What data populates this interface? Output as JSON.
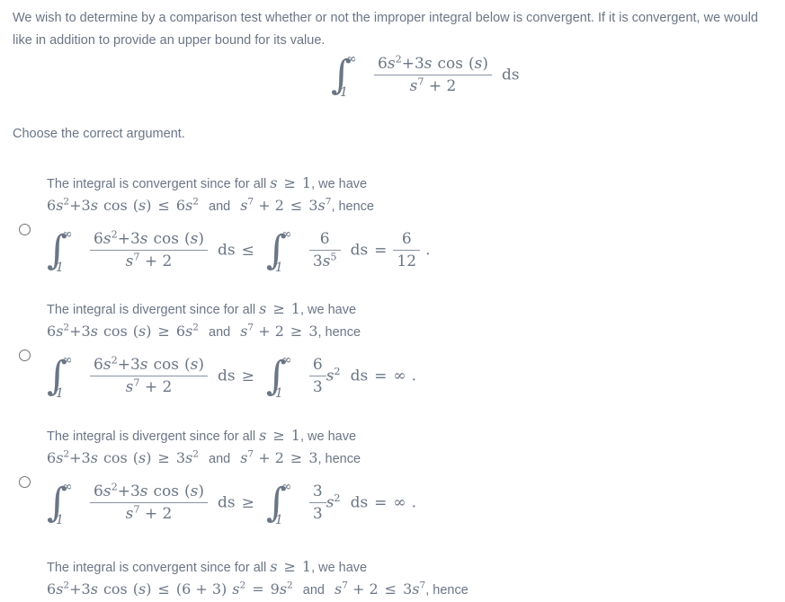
{
  "question": {
    "stem_line1": "We wish to determine by a comparison test whether or not the improper integral below is convergent. If it is convergent, we would",
    "stem_line2": "like in addition to provide an upper bound for its value.",
    "prompt": "Choose the correct argument.",
    "integral": {
      "lower_limit": "1",
      "upper_limit": "∞",
      "numerator": "6s²+3s cos (s)",
      "denominator": "s⁷ + 2",
      "differential": "ds",
      "plain": "∫₁^∞ (6s²+3s cos(s)) / (s⁷ + 2) ds"
    }
  },
  "icons": {
    "radio_unselected": "radio-unselected-icon"
  },
  "colors": {
    "text": "#6b7585",
    "math": "#6b7585",
    "rule": "#8892a0",
    "radio_border": "#737373",
    "background": "#ffffff"
  },
  "options": [
    {
      "id": "option-a",
      "selected": false,
      "line1_pre": "The integral is convergent since for all ",
      "line1_var": "s",
      "line1_rel": "≥",
      "line1_val": "1",
      "line1_post": ", we have",
      "line2": {
        "lhs_coef": "6",
        "lhs": "6s²+3s cos (s)",
        "rel1": "≤",
        "rhs1_coef": "6",
        "rhs1": "6s²",
        "and": "and",
        "lhs2": "s⁷ + 2",
        "rel2": "≤",
        "rhs2": "3s⁷",
        "tail": ", hence"
      },
      "display": {
        "left_integral_num": "6s²+3s cos (s)",
        "left_integral_den": "s⁷ + 2",
        "relation": "≤",
        "right_integral_num": "6",
        "right_integral_den": "3s⁵",
        "result_num": "6",
        "result_den": "12",
        "equals": "=",
        "period": "."
      }
    },
    {
      "id": "option-b",
      "selected": false,
      "line1_pre": "The integral is divergent since for all ",
      "line1_var": "s",
      "line1_rel": "≥",
      "line1_val": "1",
      "line1_post": ", we have",
      "line2": {
        "lhs": "6s²+3s cos (s)",
        "rel1": "≥",
        "rhs1": "6s²",
        "and": "and",
        "lhs2": "s⁷ + 2",
        "rel2": "≥",
        "rhs2": "3",
        "tail": ", hence"
      },
      "display": {
        "left_integral_num": "6s²+3s cos (s)",
        "left_integral_den": "s⁷ + 2",
        "relation": "≥",
        "right_frac_num": "6",
        "right_frac_den": "3",
        "right_factor": "s²",
        "equals": "=",
        "result": "∞",
        "period": "."
      }
    },
    {
      "id": "option-c",
      "selected": false,
      "line1_pre": "The integral is divergent since for all ",
      "line1_var": "s",
      "line1_rel": "≥",
      "line1_val": "1",
      "line1_post": ", we have",
      "line2": {
        "lhs": "6s²+3s cos (s)",
        "rel1": "≥",
        "rhs1": "3s²",
        "and": "and",
        "lhs2": "s⁷ + 2",
        "rel2": "≥",
        "rhs2": "3",
        "tail": ", hence"
      },
      "display": {
        "left_integral_num": "6s²+3s cos (s)",
        "left_integral_den": "s⁷ + 2",
        "relation": "≥",
        "right_frac_num": "3",
        "right_frac_den": "3",
        "right_factor": "s²",
        "equals": "=",
        "result": "∞",
        "period": "."
      }
    },
    {
      "id": "option-d",
      "selected": false,
      "line1_pre": "The integral is convergent since for all ",
      "line1_var": "s",
      "line1_rel": "≥",
      "line1_val": "1",
      "line1_post": ", we have",
      "line2": {
        "lhs": "6s²+3s cos (s)",
        "rel1": "≤",
        "rhs1": "(6 + 3) s²",
        "equals": "=",
        "rhs1b": "9s²",
        "and": "and",
        "lhs2": "s⁷ + 2",
        "rel2": "≤",
        "rhs2": "3s⁷",
        "tail": ", hence"
      }
    }
  ],
  "labels": {
    "and": "and",
    "we_have": ", we have",
    "hence": ", hence",
    "ds": "ds",
    "infinity": "∞",
    "one": "1"
  }
}
